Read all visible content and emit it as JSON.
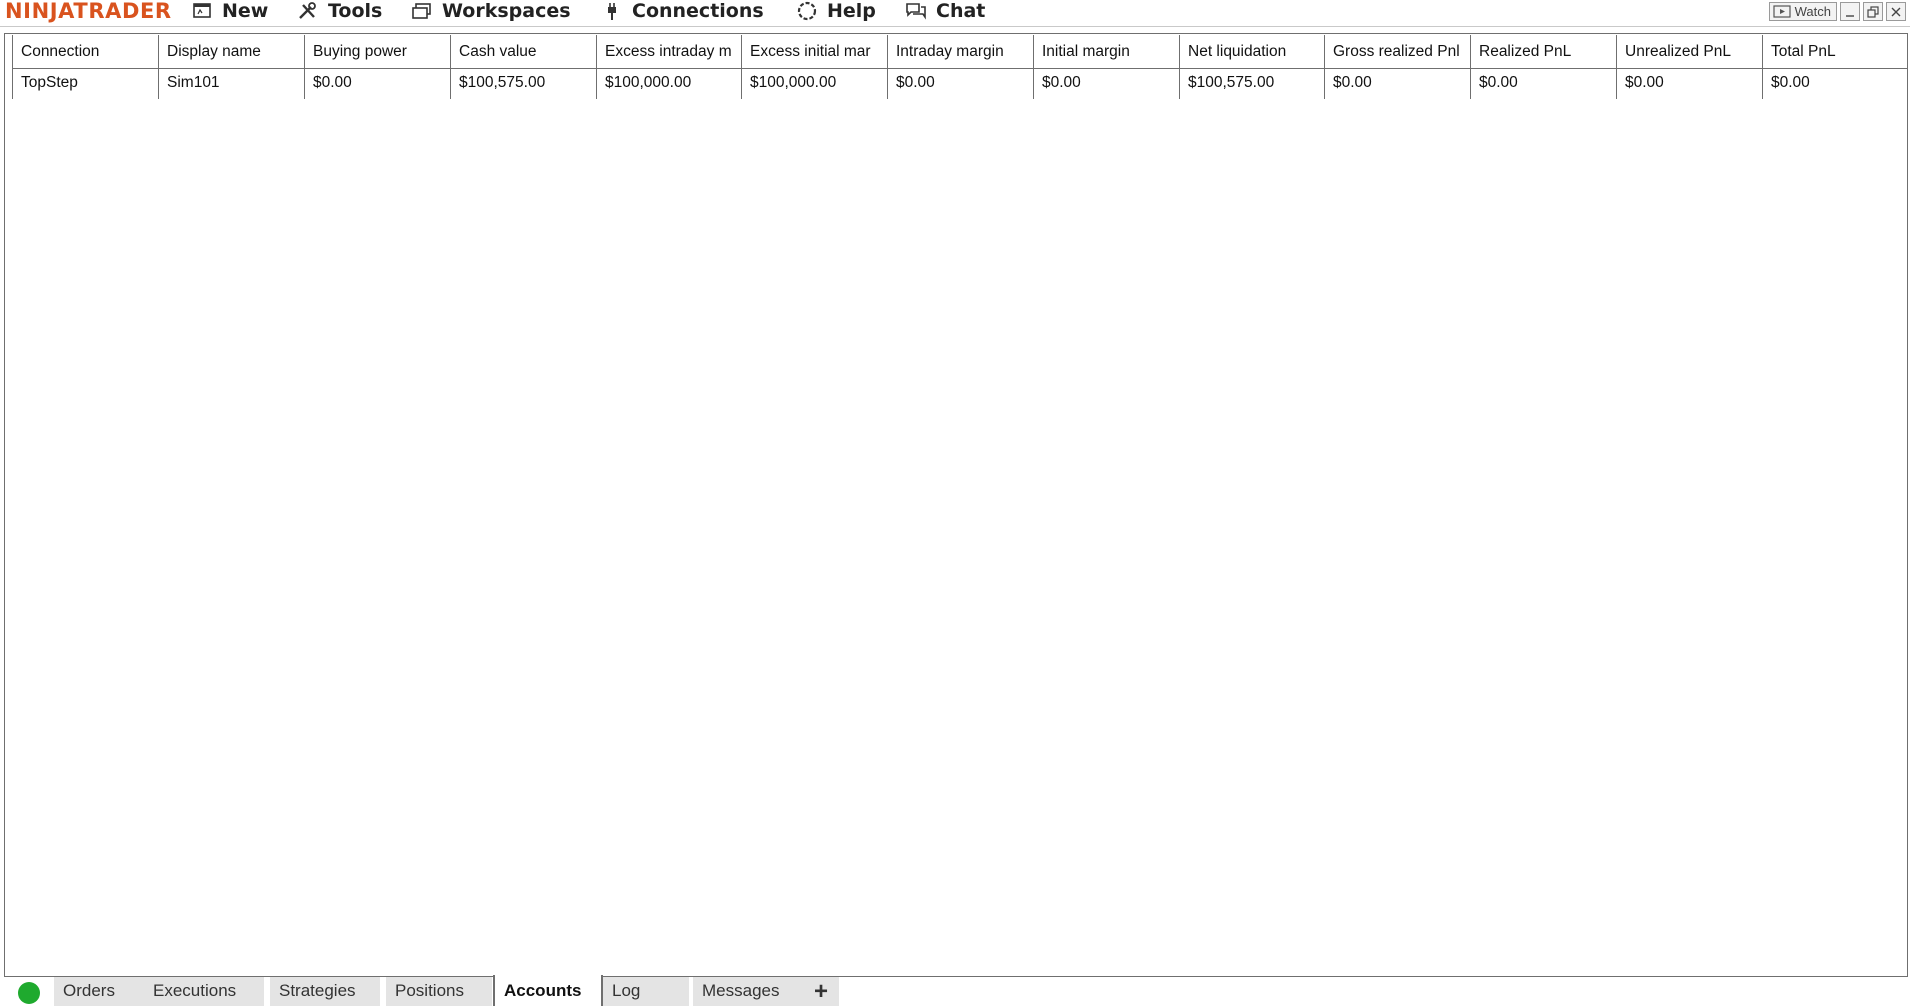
{
  "app": {
    "logo": "NINJATRADER",
    "brand_color": "#d9531e"
  },
  "menu": {
    "items": [
      {
        "label": "New",
        "icon": "new-window-icon"
      },
      {
        "label": "Tools",
        "icon": "tools-icon"
      },
      {
        "label": "Workspaces",
        "icon": "workspaces-icon"
      },
      {
        "label": "Connections",
        "icon": "plug-icon"
      },
      {
        "label": "Help",
        "icon": "lifebuoy-icon"
      },
      {
        "label": "Chat",
        "icon": "chat-icon"
      }
    ]
  },
  "window_controls": {
    "watch_label": "Watch"
  },
  "grid": {
    "columns": [
      "Connection",
      "Display name",
      "Buying power",
      "Cash value",
      "Excess intraday m",
      "Excess initial mar",
      "Intraday margin",
      "Initial margin",
      "Net liquidation",
      "Gross realized Pnl",
      "Realized PnL",
      "Unrealized PnL",
      "Total PnL"
    ],
    "rows": [
      [
        "TopStep",
        "Sim101",
        "$0.00",
        "$100,575.00",
        "$100,000.00",
        "$100,000.00",
        "$0.00",
        "$0.00",
        "$100,575.00",
        "$0.00",
        "$0.00",
        "$0.00",
        "$0.00"
      ]
    ]
  },
  "tabs": {
    "status_color": "#1faa2e",
    "items": [
      "Orders",
      "Executions",
      "Strategies",
      "Positions",
      "Accounts",
      "Log",
      "Messages"
    ],
    "active": "Accounts",
    "add_label": "+"
  }
}
